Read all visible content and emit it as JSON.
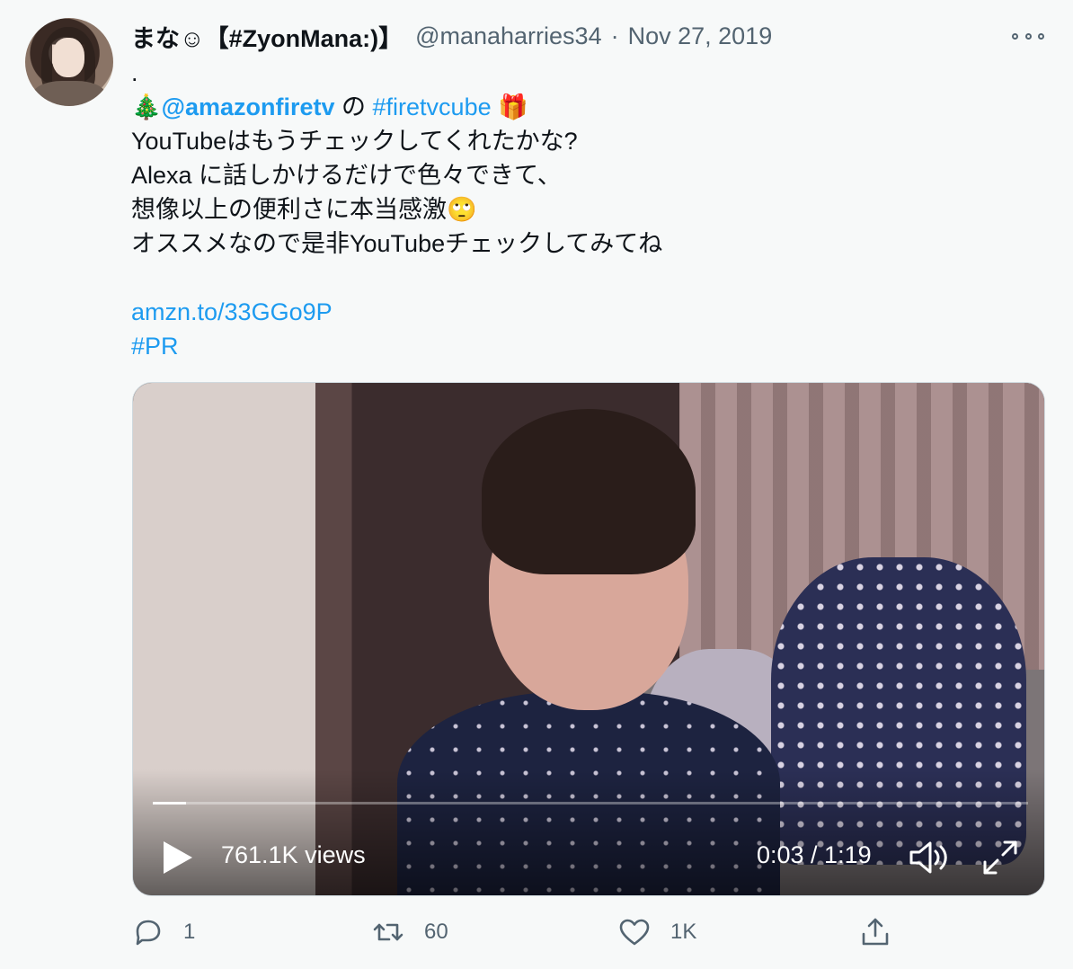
{
  "tweet": {
    "display_name": "まな☺【#ZyonMana:)】",
    "handle": "@manaharries34",
    "separator": "·",
    "date": "Nov 27, 2019",
    "more_icon": "ellipsis-icon",
    "avatar_alt": "avatar"
  },
  "body": {
    "line0": ".",
    "tree_emoji": "🎄",
    "mention": "@amazonfiretv",
    "no": " の ",
    "hashtag": "#firetvcube",
    "gift_emoji": "🎁",
    "line2": "YouTubeはもうチェックしてくれたかな?",
    "line3": "Alexa に話しかけるだけで色々できて、",
    "line4_text": "想像以上の便利さに本当感激",
    "line4_emoji": "🙄",
    "line5": "オススメなので是非YouTubeチェックしてみてね",
    "link": "amzn.to/33GGo9P",
    "hashtag_pr": "#PR"
  },
  "video": {
    "views": "761.1K views",
    "time": "0:03 / 1:19",
    "progress_fraction": 0.038,
    "play_icon": "play-icon",
    "volume_icon": "volume-icon",
    "fullscreen_icon": "fullscreen-icon"
  },
  "actions": {
    "reply_count": "1",
    "retweet_count": "60",
    "like_count": "1K",
    "reply_icon": "reply-icon",
    "retweet_icon": "retweet-icon",
    "like_icon": "heart-icon",
    "share_icon": "share-icon"
  },
  "colors": {
    "link": "#1d9bf0",
    "secondary_text": "#536471",
    "background": "#f7f9f9"
  }
}
